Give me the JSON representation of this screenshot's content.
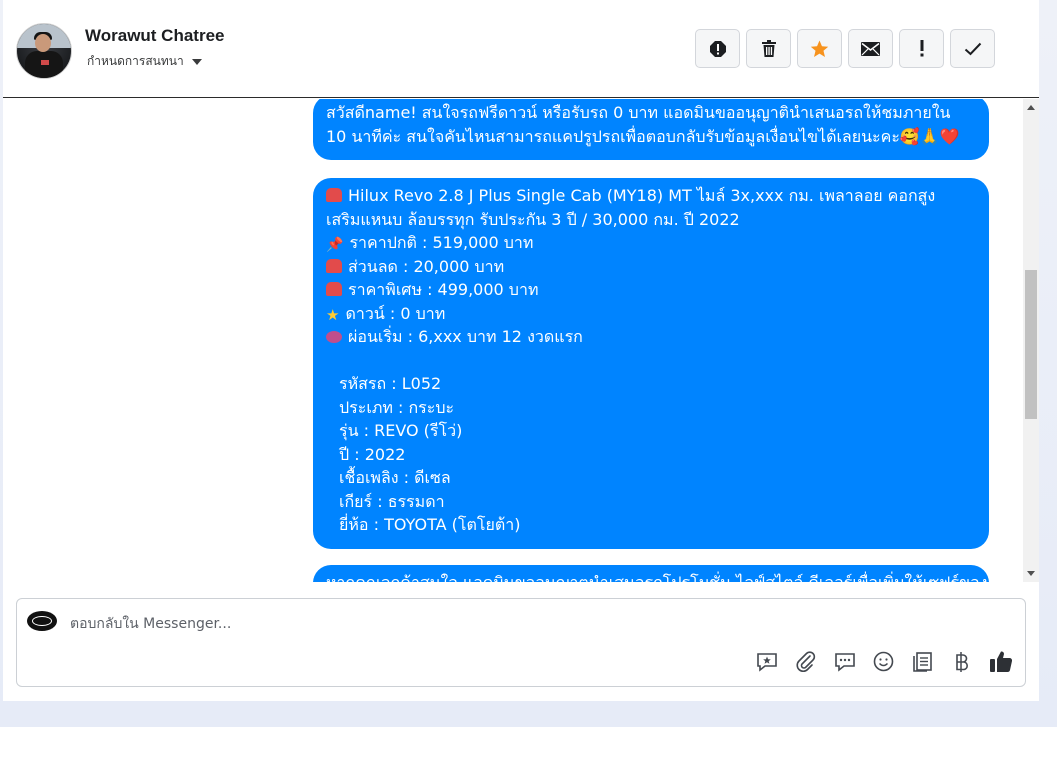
{
  "conversation": {
    "contact_name": "Worawut Chatree",
    "assign_label": "กำหนดการสนทนา"
  },
  "toolbar": {
    "buttons": [
      {
        "name": "report-button",
        "icon": "alert-octagon-icon"
      },
      {
        "name": "delete-button",
        "icon": "trash-icon"
      },
      {
        "name": "star-button",
        "icon": "star-icon",
        "color": "#f7931e"
      },
      {
        "name": "mark-unread-button",
        "icon": "envelope-icon"
      },
      {
        "name": "important-button",
        "icon": "exclamation-icon"
      },
      {
        "name": "done-button",
        "icon": "checkmark-icon"
      }
    ]
  },
  "messages": {
    "greeting": {
      "line1": "สวัสดีname! สนใจรถฟรีดาวน์ หรือรับรถ 0 บาท แอดมินขออนุญาตินำเสนอรถให้ชมภายใน",
      "line2": "10 นาทีค่ะ สนใจคันไหนสามารถแคปรูปรถเพื่อตอบกลับรับข้อมูลเงื่อนไขได้เลยนะคะ🥰🙏❤️"
    },
    "car_offer": {
      "title_line1": "Hilux Revo 2.8 J Plus Single Cab (MY18) MT ไมล์ 3x,xxx กม. เพลาลอย คอกสูง",
      "title_line2": "เสริมแหนบ ล้อบรรทุก รับประกัน 3 ปี / 30,000 กม. ปี 2022",
      "price_normal": "ราคาปกติ : 519,000 บาท",
      "discount": "ส่วนลด : 20,000 บาท",
      "price_special": "ราคาพิเศษ : 499,000 บาท",
      "down": "ดาวน์ : 0 บาท",
      "installment": "ผ่อนเริ่ม : 6,xxx บาท 12 งวดแรก",
      "car_code": "รหัสรถ : L052",
      "type": "ประเภท : กระบะ",
      "model": "รุ่น : REVO (รีโว่)",
      "year": "ปี : 2022",
      "fuel": "เชื้อเพลิง : ดีเซล",
      "gear": "เกียร์ : ธรรมดา",
      "brand": "ยี่ห้อ : TOYOTA (โตโยต้า)"
    },
    "partial": {
      "line1": "หากคุณลูกค้าสนใจ แอดมินขออนุญาตนำเสนอรถโปรโมชั่น ไลฟ์สไตล์ ดีเลอร์เพื่อเพิ่มให้เซฟร์ของ"
    }
  },
  "composer": {
    "placeholder": "ตอบกลับใน Messenger...",
    "tools": [
      "saved-reply-icon",
      "attachment-icon",
      "comment-icon",
      "emoji-icon",
      "notes-icon",
      "baht-icon",
      "thumbs-up-icon"
    ]
  }
}
